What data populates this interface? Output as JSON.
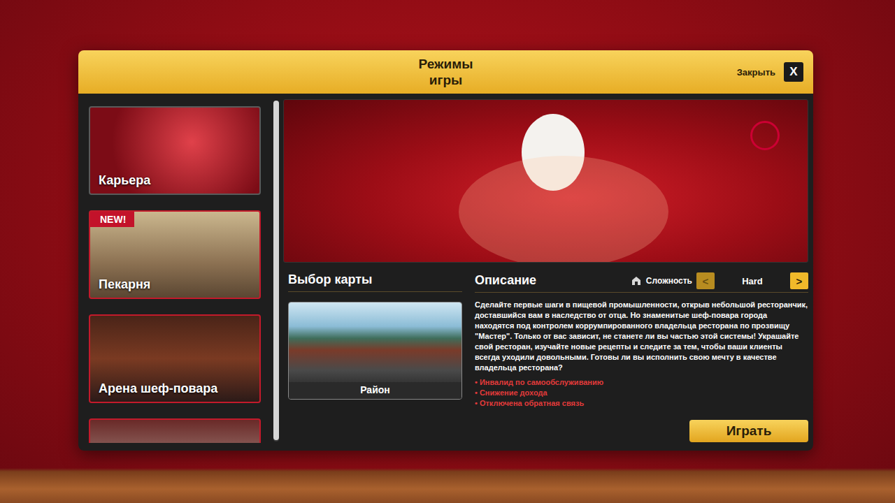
{
  "dialog": {
    "title": "Режимы игры",
    "close_label": "Закрыть",
    "close_icon": "X"
  },
  "modes": [
    {
      "label": "Карьера",
      "badge": "",
      "selected": true
    },
    {
      "label": "Пекарня",
      "badge": "NEW!",
      "selected": false
    },
    {
      "label": "Арена шеф-повара",
      "badge": "",
      "selected": false
    },
    {
      "label": "",
      "badge": "",
      "selected": false
    }
  ],
  "map_section": {
    "title": "Выбор карты",
    "maps": [
      {
        "label": "Район",
        "selected": true
      }
    ]
  },
  "description": {
    "title": "Описание",
    "text": "Сделайте первые шаги в пищевой промышленности, открыв небольшой ресторанчик, доставшийся вам в наследство от отца. Но знаменитые шеф-повара города находятся под контролем коррумпированного владельца ресторана по прозвищу \"Мастер\". Только от вас зависит, не станете ли вы частью этой системы! Украшайте свой ресторан, изучайте новые рецепты и следите за тем, чтобы ваши клиенты всегда уходили довольными. Готовы ли вы исполнить свою мечту в качестве владельца ресторана?",
    "bullet": "•",
    "modifiers": [
      "Инвалид по самообслуживанию",
      "Снижение дохода",
      "Отключена обратная связь"
    ]
  },
  "difficulty": {
    "label": "Сложность",
    "value": "Hard",
    "prev_icon": "<",
    "next_icon": ">",
    "prev_disabled": true,
    "next_disabled": false
  },
  "play_button": "Играть"
}
